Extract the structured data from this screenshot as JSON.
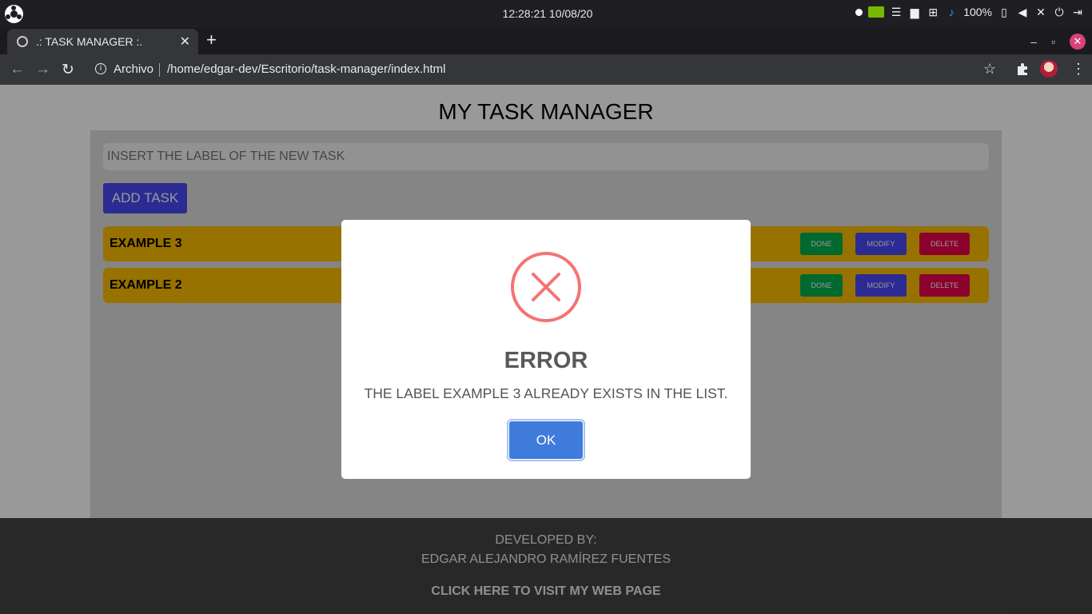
{
  "system": {
    "clock": "12:28:21  10/08/20",
    "battery": "100%"
  },
  "browser": {
    "tab_title": ".: TASK MANAGER :.",
    "scheme_label": "Archivo",
    "url": "/home/edgar-dev/Escritorio/task-manager/index.html"
  },
  "page": {
    "title": "MY TASK MANAGER",
    "input": {
      "placeholder": "INSERT THE LABEL OF THE NEW TASK",
      "value": ""
    },
    "add_button": "ADD TASK",
    "tasks": [
      {
        "label": "EXAMPLE 3",
        "done": "DONE",
        "modify": "MODIFY",
        "delete": "DELETE"
      },
      {
        "label": "EXAMPLE 2",
        "done": "DONE",
        "modify": "MODIFY",
        "delete": "DELETE"
      }
    ],
    "footer": {
      "developed_by": "DEVELOPED BY:",
      "author": "EDGAR ALEJANDRO RAMÍREZ FUENTES",
      "link": "CLICK HERE TO VISIT MY WEB PAGE"
    }
  },
  "dialog": {
    "icon": "error-x-icon",
    "title": "ERROR",
    "message": "THE LABEL EXAMPLE 3 ALREADY EXISTS IN THE LIST.",
    "ok_label": "OK"
  },
  "colors": {
    "task_bg": "#fcbf00",
    "done": "#00b050",
    "modify": "#4848f6",
    "delete": "#e8004a",
    "error": "#f27474",
    "ok_button": "#3f7bdb"
  }
}
